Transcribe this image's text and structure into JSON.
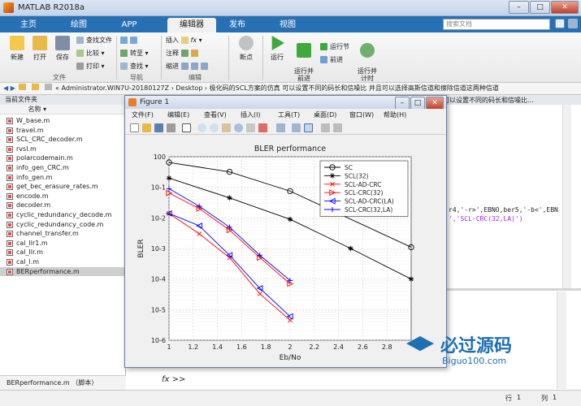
{
  "app": {
    "title": "MATLAB R2018a"
  },
  "tabs": [
    "主页",
    "绘图",
    "APP",
    "编辑器",
    "发布",
    "视图"
  ],
  "search": {
    "placeholder": "搜索文档"
  },
  "ribbon": {
    "new": "新建",
    "open": "打开",
    "save": "保存",
    "find_files": "查找文件",
    "compare": "比较",
    "print": "打印",
    "file_group": "文件",
    "goto": "转至",
    "find": "查找",
    "nav_group": "导航",
    "insert": "插入",
    "fx": "fx",
    "comment": "注释",
    "indent": "缩进",
    "edit_group": "编辑",
    "breakpoints": "断点",
    "run": "运行",
    "run_advance": "运行并\n前进",
    "run_section": "运行节",
    "advance": "前进",
    "run_time": "运行并\n计时"
  },
  "address": {
    "path": "« Administrator.WIN7U-20180127Z  ›  Desktop  ›  极化码的SCL方案的仿真 可以设置不同的码长和信噪比 并且可以选择高斯信道和擦除信道这两种信道"
  },
  "leftpanel": {
    "title": "当前文件夹",
    "col_name": "名称 ▾",
    "files": [
      "W_base.m",
      "travel.m",
      "SCL_CRC_decoder.m",
      "rvsl.m",
      "polarcodemain.m",
      "info_gen_CRC.m",
      "info_gen.m",
      "get_bec_erasure_rates.m",
      "encode.m",
      "decoder.m",
      "cyclic_redundancy_decode.m",
      "cyclic_redundancy_code.m",
      "channel_transfer.m",
      "cal_llr1.m",
      "cal_llr.m",
      "cal_l.m",
      "BERperformance.m"
    ],
    "selected": "BERperformance.m",
    "detail": "BERperformance.m （脚本）"
  },
  "editor_snippet": {
    "tab_text": "可以设置不同的码长和信噪比...",
    "line1": "r4,'-r>',EBNO,ber5,'-b<',EBN",
    "line2": "','SCL-CRC(32,LA)')"
  },
  "command": {
    "prompt": "fx  >>"
  },
  "status": {
    "row_label": "行",
    "row": "1",
    "col_label": "列",
    "col": "1"
  },
  "figure": {
    "title": "Figure 1",
    "menu": [
      "文件(F)",
      "编辑(E)",
      "查看(V)",
      "插入(I)",
      "工具(T)",
      "桌面(D)",
      "窗口(W)",
      "帮助(H)"
    ]
  },
  "watermark": {
    "text": "必过源码",
    "url": "Biguo100.com"
  },
  "chart_data": {
    "type": "line",
    "title": "BLER performance",
    "xlabel": "Eb/No",
    "ylabel": "BLER",
    "yscale": "log",
    "xlim": [
      1,
      3
    ],
    "ylim": [
      1e-06,
      1
    ],
    "xticks": [
      "1",
      "1.2",
      "1.4",
      "1.6",
      "1.8",
      "2",
      "2.2",
      "2.4",
      "2.6",
      "2.8"
    ],
    "yticks": [
      "10^0",
      "10^-1",
      "10^-2",
      "10^-3",
      "10^-4",
      "10^-5",
      "10^-6"
    ],
    "grid": true,
    "legend_position": "top-right",
    "series": [
      {
        "name": "SC",
        "color": "#000000",
        "marker": "o",
        "x": [
          1,
          1.5,
          2,
          3
        ],
        "y": [
          0.65,
          0.32,
          0.075,
          0.0011
        ]
      },
      {
        "name": "SCL(32)",
        "color": "#000000",
        "marker": "*",
        "x": [
          1,
          1.5,
          2,
          2.5,
          3
        ],
        "y": [
          0.2,
          0.045,
          0.009,
          0.001,
          0.0001
        ]
      },
      {
        "name": "SCL-AD-CRC",
        "color": "#ff0000",
        "marker": "x",
        "x": [
          1,
          1.25,
          1.5,
          1.75,
          2
        ],
        "y": [
          0.014,
          0.003,
          0.0005,
          3.3e-05,
          4.5e-06
        ]
      },
      {
        "name": "SCL-CRC(32)",
        "color": "#ff0000",
        "marker": ">",
        "x": [
          1,
          1.25,
          1.5,
          1.75,
          2
        ],
        "y": [
          0.065,
          0.02,
          0.004,
          0.0005,
          7e-05
        ]
      },
      {
        "name": "SCL-AD-CRC(LA)",
        "color": "#0000ff",
        "marker": "<",
        "x": [
          1,
          1.25,
          1.5,
          1.75,
          2
        ],
        "y": [
          0.014,
          0.0055,
          0.0006,
          5e-05,
          6e-06
        ]
      },
      {
        "name": "SCL-CRC(32,LA)",
        "color": "#0000ff",
        "marker": "+",
        "x": [
          1,
          1.25,
          1.5,
          1.75,
          2
        ],
        "y": [
          0.09,
          0.024,
          0.005,
          0.0006,
          9e-05
        ]
      }
    ]
  }
}
